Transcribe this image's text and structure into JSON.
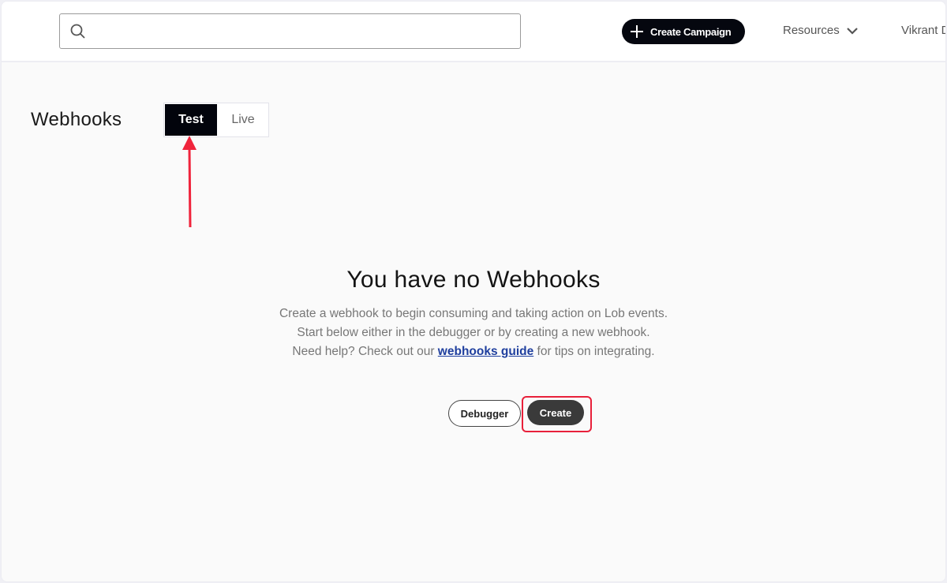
{
  "topbar": {
    "search": {
      "value": "",
      "placeholder": ""
    },
    "create_campaign_label": "Create Campaign",
    "resources_label": "Resources",
    "user_name": "Vikrant D"
  },
  "page": {
    "title": "Webhooks",
    "toggle": {
      "options": [
        "Test",
        "Live"
      ],
      "selected": "Test"
    }
  },
  "empty_state": {
    "title": "You have no Webhooks",
    "line1": "Create a webhook to begin consuming and taking action on Lob events.",
    "line2": "Start below either in the debugger or by creating a new webhook.",
    "line3_before": "Need help? Check out our ",
    "line3_link": "webhooks guide",
    "line3_after": " for tips on integrating.",
    "debugger_label": "Debugger",
    "create_label": "Create"
  },
  "annotations": {
    "highlight_color": "#e8203a",
    "arrow_color": "#f0243c"
  }
}
